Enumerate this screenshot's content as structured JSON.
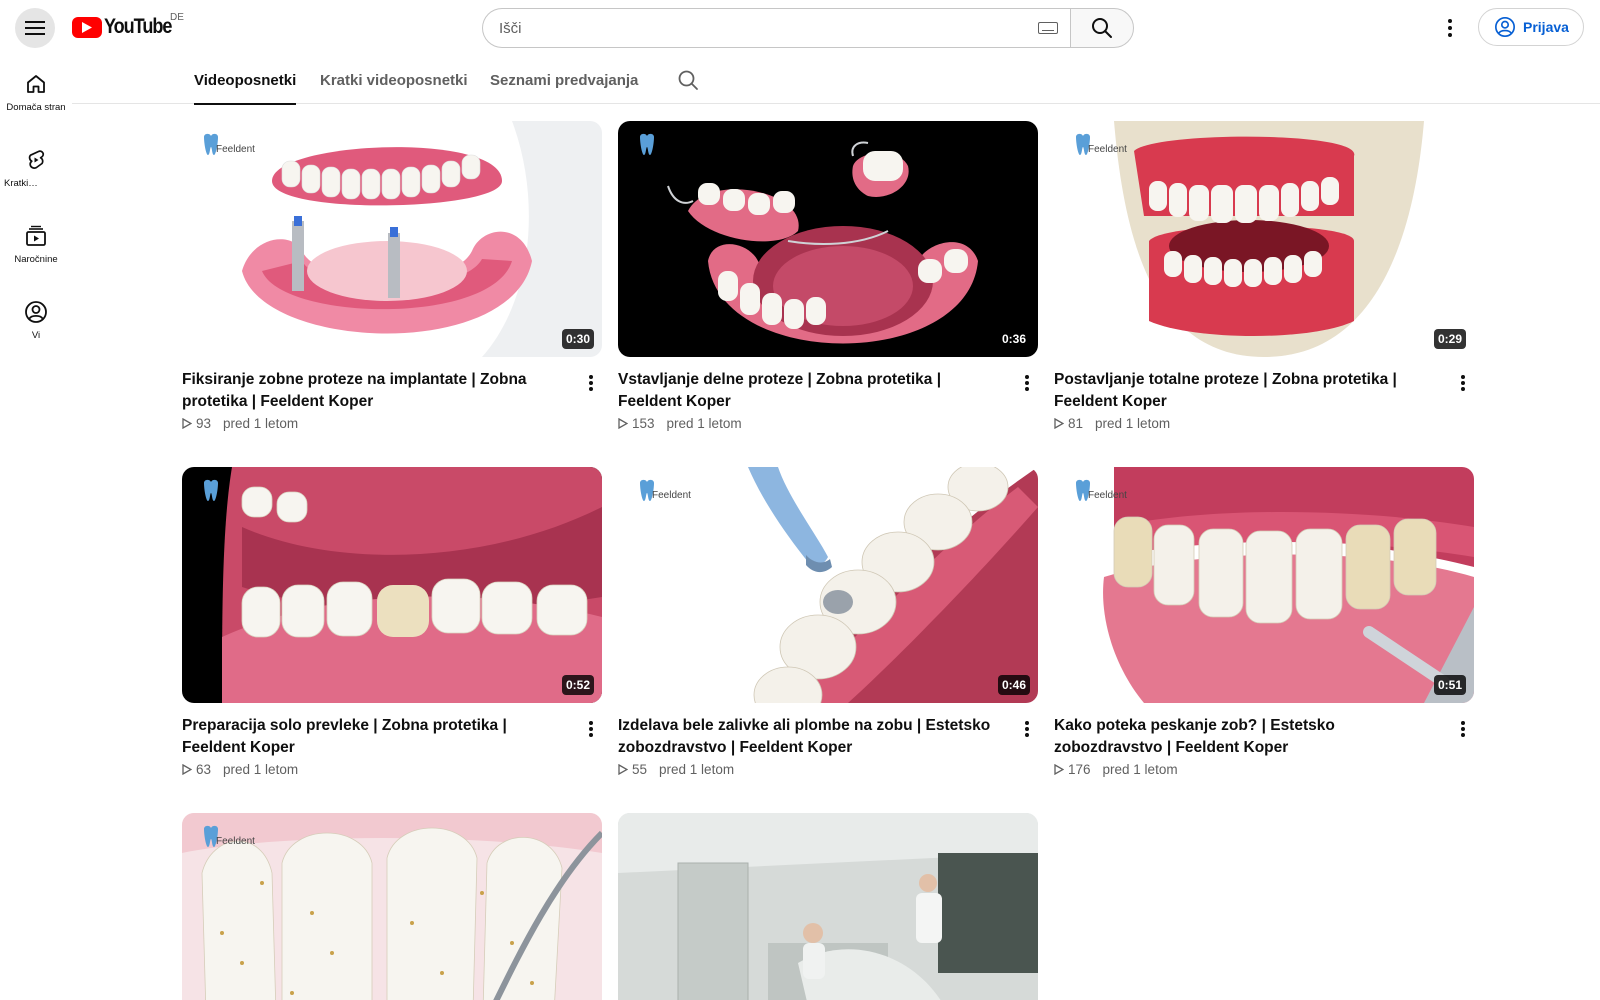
{
  "header": {
    "logo_text": "YouTube",
    "country_code": "DE",
    "search_placeholder": "Išči",
    "signin_label": "Prijava"
  },
  "guide": {
    "items": [
      {
        "label": "Domača stran",
        "icon": "home-icon"
      },
      {
        "label": "Kratki…",
        "icon": "shorts-icon"
      },
      {
        "label": "Naročnine",
        "icon": "subscriptions-icon"
      },
      {
        "label": "Vi",
        "icon": "you-icon"
      }
    ]
  },
  "tabs": [
    {
      "label": "Videoposnetki",
      "active": true
    },
    {
      "label": "Kratki videoposnetki",
      "active": false
    },
    {
      "label": "Seznami predvajanja",
      "active": false
    }
  ],
  "watermark": "Feeldent",
  "videos": [
    {
      "title": "Fiksiranje zobne proteze na implantate | Zobna protetika | Feeldent Koper",
      "duration": "0:30",
      "views": "93",
      "age": "pred 1 letom"
    },
    {
      "title": "Vstavljanje delne proteze | Zobna protetika | Feeldent Koper",
      "duration": "0:36",
      "views": "153",
      "age": "pred 1 letom"
    },
    {
      "title": "Postavljanje totalne proteze |  Zobna protetika | Feeldent Koper",
      "duration": "0:29",
      "views": "81",
      "age": "pred 1 letom"
    },
    {
      "title": "Preparacija solo prevleke | Zobna protetika | Feeldent Koper",
      "duration": "0:52",
      "views": "63",
      "age": "pred 1 letom"
    },
    {
      "title": "Izdelava bele zalivke ali plombe na zobu | Estetsko zobozdravstvo | Feeldent Koper",
      "duration": "0:46",
      "views": "55",
      "age": "pred 1 letom"
    },
    {
      "title": "Kako poteka peskanje zob? | Estetsko zobozdravstvo | Feeldent Koper",
      "duration": "0:51",
      "views": "176",
      "age": "pred 1 letom"
    },
    {
      "title": "",
      "duration": "",
      "views": "",
      "age": ""
    },
    {
      "title": "",
      "duration": "",
      "views": "",
      "age": ""
    }
  ],
  "colors": {
    "brand_red": "#ff0000",
    "link_blue": "#065fd4",
    "secondary_text": "#606060",
    "gum_pink": "#e05a7c",
    "tooth_white": "#f4f1ea"
  }
}
